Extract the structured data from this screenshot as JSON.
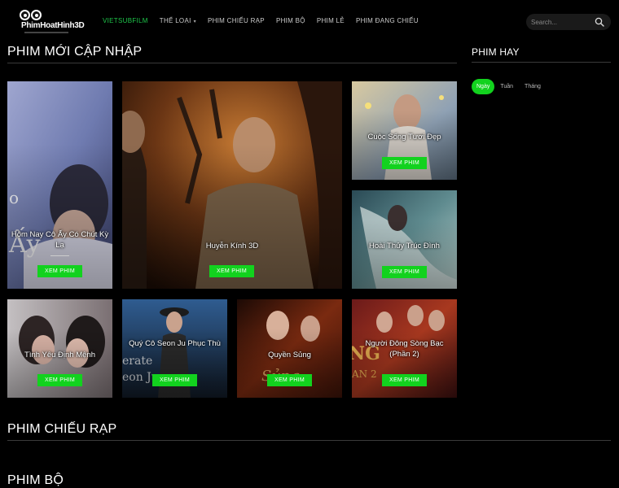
{
  "logo": {
    "text": "PhimHoatHinh3D"
  },
  "nav": [
    {
      "label": "VIETSUBFILM",
      "active": true,
      "dropdown": false
    },
    {
      "label": "THỂ LOẠI",
      "active": false,
      "dropdown": true
    },
    {
      "label": "PHIM CHIẾU RẠP",
      "active": false,
      "dropdown": false
    },
    {
      "label": "PHIM BỘ",
      "active": false,
      "dropdown": false
    },
    {
      "label": "PHIM LẺ",
      "active": false,
      "dropdown": false
    },
    {
      "label": "PHIM ĐANG CHIẾU",
      "active": false,
      "dropdown": false
    }
  ],
  "search": {
    "placeholder": "Search..."
  },
  "sections": {
    "new_updates": "PHIM MỚI CẬP NHẬP",
    "theatrical": "PHIM CHIẾU RẠP",
    "series": "PHIM BỘ"
  },
  "sidebar": {
    "title": "PHIM HAY",
    "tabs": [
      "Ngày",
      "Tuần",
      "Tháng"
    ],
    "active_tab": 0
  },
  "watch_label": "XEM PHIM",
  "movies": [
    {
      "title": "Hôm Nay Cô Ấy Có Chút Kỳ Lạ"
    },
    {
      "title": "Huyễn Kính 3D"
    },
    {
      "title": "Cuộc Sống Tươi Đẹp"
    },
    {
      "title": "Hoài Thủy Trúc Đình"
    },
    {
      "title": "Tình Yêu Định Mệnh"
    },
    {
      "title": "Quý Cô Seon Ju Phục Thù"
    },
    {
      "title": "Quyền Sủng"
    },
    {
      "title": "Người Đông Sòng Bạc (Phần 2)"
    }
  ],
  "colors": {
    "accent": "#12d21e",
    "nav_active": "#1ec64a",
    "background": "#000000"
  }
}
